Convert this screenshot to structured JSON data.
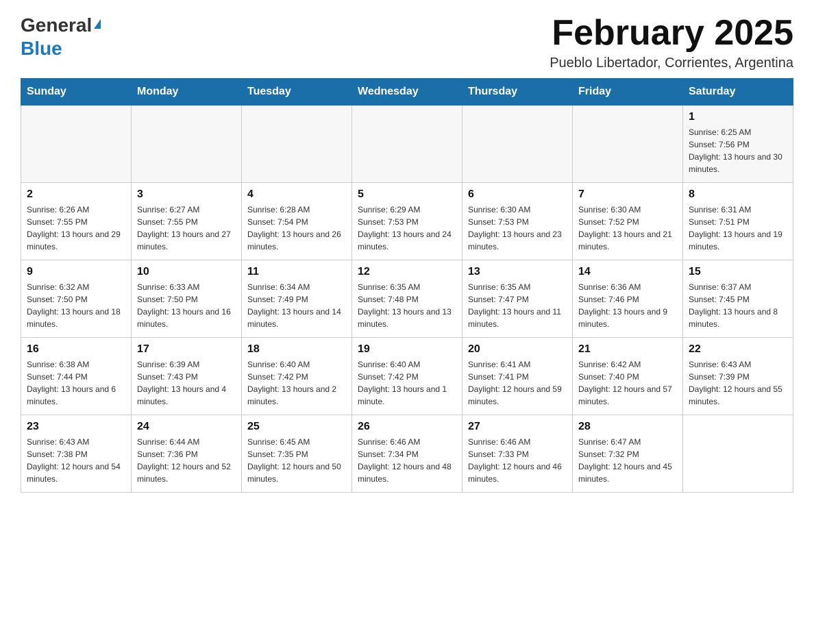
{
  "header": {
    "logo_general": "General",
    "logo_blue": "Blue",
    "month_title": "February 2025",
    "location": "Pueblo Libertador, Corrientes, Argentina"
  },
  "calendar": {
    "days_of_week": [
      "Sunday",
      "Monday",
      "Tuesday",
      "Wednesday",
      "Thursday",
      "Friday",
      "Saturday"
    ],
    "weeks": [
      [
        {
          "day": "",
          "sunrise": "",
          "sunset": "",
          "daylight": "",
          "empty": true
        },
        {
          "day": "",
          "sunrise": "",
          "sunset": "",
          "daylight": "",
          "empty": true
        },
        {
          "day": "",
          "sunrise": "",
          "sunset": "",
          "daylight": "",
          "empty": true
        },
        {
          "day": "",
          "sunrise": "",
          "sunset": "",
          "daylight": "",
          "empty": true
        },
        {
          "day": "",
          "sunrise": "",
          "sunset": "",
          "daylight": "",
          "empty": true
        },
        {
          "day": "",
          "sunrise": "",
          "sunset": "",
          "daylight": "",
          "empty": true
        },
        {
          "day": "1",
          "sunrise": "Sunrise: 6:25 AM",
          "sunset": "Sunset: 7:56 PM",
          "daylight": "Daylight: 13 hours and 30 minutes.",
          "empty": false
        }
      ],
      [
        {
          "day": "2",
          "sunrise": "Sunrise: 6:26 AM",
          "sunset": "Sunset: 7:55 PM",
          "daylight": "Daylight: 13 hours and 29 minutes.",
          "empty": false
        },
        {
          "day": "3",
          "sunrise": "Sunrise: 6:27 AM",
          "sunset": "Sunset: 7:55 PM",
          "daylight": "Daylight: 13 hours and 27 minutes.",
          "empty": false
        },
        {
          "day": "4",
          "sunrise": "Sunrise: 6:28 AM",
          "sunset": "Sunset: 7:54 PM",
          "daylight": "Daylight: 13 hours and 26 minutes.",
          "empty": false
        },
        {
          "day": "5",
          "sunrise": "Sunrise: 6:29 AM",
          "sunset": "Sunset: 7:53 PM",
          "daylight": "Daylight: 13 hours and 24 minutes.",
          "empty": false
        },
        {
          "day": "6",
          "sunrise": "Sunrise: 6:30 AM",
          "sunset": "Sunset: 7:53 PM",
          "daylight": "Daylight: 13 hours and 23 minutes.",
          "empty": false
        },
        {
          "day": "7",
          "sunrise": "Sunrise: 6:30 AM",
          "sunset": "Sunset: 7:52 PM",
          "daylight": "Daylight: 13 hours and 21 minutes.",
          "empty": false
        },
        {
          "day": "8",
          "sunrise": "Sunrise: 6:31 AM",
          "sunset": "Sunset: 7:51 PM",
          "daylight": "Daylight: 13 hours and 19 minutes.",
          "empty": false
        }
      ],
      [
        {
          "day": "9",
          "sunrise": "Sunrise: 6:32 AM",
          "sunset": "Sunset: 7:50 PM",
          "daylight": "Daylight: 13 hours and 18 minutes.",
          "empty": false
        },
        {
          "day": "10",
          "sunrise": "Sunrise: 6:33 AM",
          "sunset": "Sunset: 7:50 PM",
          "daylight": "Daylight: 13 hours and 16 minutes.",
          "empty": false
        },
        {
          "day": "11",
          "sunrise": "Sunrise: 6:34 AM",
          "sunset": "Sunset: 7:49 PM",
          "daylight": "Daylight: 13 hours and 14 minutes.",
          "empty": false
        },
        {
          "day": "12",
          "sunrise": "Sunrise: 6:35 AM",
          "sunset": "Sunset: 7:48 PM",
          "daylight": "Daylight: 13 hours and 13 minutes.",
          "empty": false
        },
        {
          "day": "13",
          "sunrise": "Sunrise: 6:35 AM",
          "sunset": "Sunset: 7:47 PM",
          "daylight": "Daylight: 13 hours and 11 minutes.",
          "empty": false
        },
        {
          "day": "14",
          "sunrise": "Sunrise: 6:36 AM",
          "sunset": "Sunset: 7:46 PM",
          "daylight": "Daylight: 13 hours and 9 minutes.",
          "empty": false
        },
        {
          "day": "15",
          "sunrise": "Sunrise: 6:37 AM",
          "sunset": "Sunset: 7:45 PM",
          "daylight": "Daylight: 13 hours and 8 minutes.",
          "empty": false
        }
      ],
      [
        {
          "day": "16",
          "sunrise": "Sunrise: 6:38 AM",
          "sunset": "Sunset: 7:44 PM",
          "daylight": "Daylight: 13 hours and 6 minutes.",
          "empty": false
        },
        {
          "day": "17",
          "sunrise": "Sunrise: 6:39 AM",
          "sunset": "Sunset: 7:43 PM",
          "daylight": "Daylight: 13 hours and 4 minutes.",
          "empty": false
        },
        {
          "day": "18",
          "sunrise": "Sunrise: 6:40 AM",
          "sunset": "Sunset: 7:42 PM",
          "daylight": "Daylight: 13 hours and 2 minutes.",
          "empty": false
        },
        {
          "day": "19",
          "sunrise": "Sunrise: 6:40 AM",
          "sunset": "Sunset: 7:42 PM",
          "daylight": "Daylight: 13 hours and 1 minute.",
          "empty": false
        },
        {
          "day": "20",
          "sunrise": "Sunrise: 6:41 AM",
          "sunset": "Sunset: 7:41 PM",
          "daylight": "Daylight: 12 hours and 59 minutes.",
          "empty": false
        },
        {
          "day": "21",
          "sunrise": "Sunrise: 6:42 AM",
          "sunset": "Sunset: 7:40 PM",
          "daylight": "Daylight: 12 hours and 57 minutes.",
          "empty": false
        },
        {
          "day": "22",
          "sunrise": "Sunrise: 6:43 AM",
          "sunset": "Sunset: 7:39 PM",
          "daylight": "Daylight: 12 hours and 55 minutes.",
          "empty": false
        }
      ],
      [
        {
          "day": "23",
          "sunrise": "Sunrise: 6:43 AM",
          "sunset": "Sunset: 7:38 PM",
          "daylight": "Daylight: 12 hours and 54 minutes.",
          "empty": false
        },
        {
          "day": "24",
          "sunrise": "Sunrise: 6:44 AM",
          "sunset": "Sunset: 7:36 PM",
          "daylight": "Daylight: 12 hours and 52 minutes.",
          "empty": false
        },
        {
          "day": "25",
          "sunrise": "Sunrise: 6:45 AM",
          "sunset": "Sunset: 7:35 PM",
          "daylight": "Daylight: 12 hours and 50 minutes.",
          "empty": false
        },
        {
          "day": "26",
          "sunrise": "Sunrise: 6:46 AM",
          "sunset": "Sunset: 7:34 PM",
          "daylight": "Daylight: 12 hours and 48 minutes.",
          "empty": false
        },
        {
          "day": "27",
          "sunrise": "Sunrise: 6:46 AM",
          "sunset": "Sunset: 7:33 PM",
          "daylight": "Daylight: 12 hours and 46 minutes.",
          "empty": false
        },
        {
          "day": "28",
          "sunrise": "Sunrise: 6:47 AM",
          "sunset": "Sunset: 7:32 PM",
          "daylight": "Daylight: 12 hours and 45 minutes.",
          "empty": false
        },
        {
          "day": "",
          "sunrise": "",
          "sunset": "",
          "daylight": "",
          "empty": true
        }
      ]
    ]
  }
}
